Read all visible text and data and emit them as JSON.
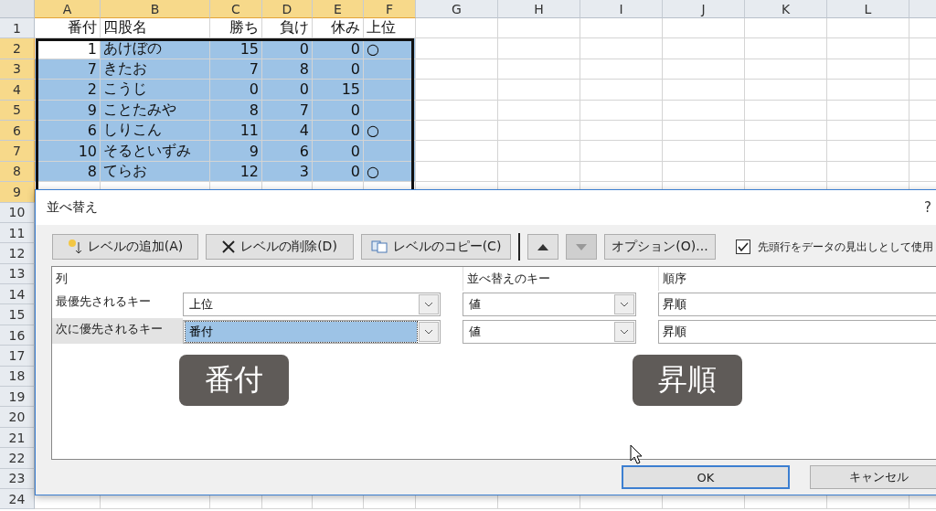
{
  "sheet": {
    "columns": [
      {
        "label": "A",
        "selected": true
      },
      {
        "label": "B",
        "selected": true
      },
      {
        "label": "C",
        "selected": true
      },
      {
        "label": "D",
        "selected": true
      },
      {
        "label": "E",
        "selected": true
      },
      {
        "label": "F",
        "selected": true
      },
      {
        "label": "G",
        "selected": false
      },
      {
        "label": "H",
        "selected": false
      },
      {
        "label": "I",
        "selected": false
      },
      {
        "label": "J",
        "selected": false
      },
      {
        "label": "K",
        "selected": false
      },
      {
        "label": "L",
        "selected": false
      }
    ],
    "row_headers": [
      {
        "label": "1",
        "selected": false
      },
      {
        "label": "2",
        "selected": true
      },
      {
        "label": "3",
        "selected": true
      },
      {
        "label": "4",
        "selected": true
      },
      {
        "label": "5",
        "selected": true
      },
      {
        "label": "6",
        "selected": true
      },
      {
        "label": "7",
        "selected": true
      },
      {
        "label": "8",
        "selected": true
      },
      {
        "label": "9",
        "selected": true
      },
      {
        "label": "10",
        "selected": false
      },
      {
        "label": "11",
        "selected": false
      },
      {
        "label": "12",
        "selected": false
      },
      {
        "label": "13",
        "selected": false
      },
      {
        "label": "14",
        "selected": false
      },
      {
        "label": "15",
        "selected": false
      },
      {
        "label": "16",
        "selected": false
      },
      {
        "label": "17",
        "selected": false
      },
      {
        "label": "18",
        "selected": false
      },
      {
        "label": "19",
        "selected": false
      },
      {
        "label": "20",
        "selected": false
      },
      {
        "label": "21",
        "selected": false
      },
      {
        "label": "22",
        "selected": false
      },
      {
        "label": "23",
        "selected": false
      },
      {
        "label": "24",
        "selected": false
      }
    ],
    "rows": [
      {
        "cells": [
          {
            "text": "番付",
            "selected": false
          },
          {
            "text": "四股名",
            "selected": false
          },
          {
            "text": "勝ち",
            "selected": false
          },
          {
            "text": "負け",
            "selected": false
          },
          {
            "text": "休み",
            "selected": false
          },
          {
            "text": "上位",
            "selected": false
          }
        ]
      },
      {
        "cells": [
          {
            "text": "1",
            "selected": false
          },
          {
            "text": "あけぼの",
            "selected": true
          },
          {
            "text": "15",
            "selected": true
          },
          {
            "text": "0",
            "selected": true
          },
          {
            "text": "0",
            "selected": true
          },
          {
            "text": "○",
            "selected": true
          }
        ]
      },
      {
        "cells": [
          {
            "text": "7",
            "selected": true
          },
          {
            "text": "きたお",
            "selected": true
          },
          {
            "text": "7",
            "selected": true
          },
          {
            "text": "8",
            "selected": true
          },
          {
            "text": "0",
            "selected": true
          },
          {
            "selected": true
          }
        ]
      },
      {
        "cells": [
          {
            "text": "2",
            "selected": true
          },
          {
            "text": "こうじ",
            "selected": true
          },
          {
            "text": "0",
            "selected": true
          },
          {
            "text": "0",
            "selected": true
          },
          {
            "text": "15",
            "selected": true
          },
          {
            "selected": true
          }
        ]
      },
      {
        "cells": [
          {
            "text": "9",
            "selected": true
          },
          {
            "text": "ことたみや",
            "selected": true
          },
          {
            "text": "8",
            "selected": true
          },
          {
            "text": "7",
            "selected": true
          },
          {
            "text": "0",
            "selected": true
          },
          {
            "selected": true
          }
        ]
      },
      {
        "cells": [
          {
            "text": "6",
            "selected": true
          },
          {
            "text": "しりこん",
            "selected": true
          },
          {
            "text": "11",
            "selected": true
          },
          {
            "text": "4",
            "selected": true
          },
          {
            "text": "0",
            "selected": true
          },
          {
            "text": "○",
            "selected": true
          }
        ]
      },
      {
        "cells": [
          {
            "text": "10",
            "selected": true
          },
          {
            "text": "そるといずみ",
            "selected": true
          },
          {
            "text": "9",
            "selected": true
          },
          {
            "text": "6",
            "selected": true
          },
          {
            "text": "0",
            "selected": true
          },
          {
            "selected": true
          }
        ]
      },
      {
        "cells": [
          {
            "text": "8",
            "selected": true
          },
          {
            "text": "てらお",
            "selected": true
          },
          {
            "text": "12",
            "selected": true
          },
          {
            "text": "3",
            "selected": true
          },
          {
            "text": "0",
            "selected": true
          },
          {
            "text": "○",
            "selected": true
          }
        ]
      }
    ]
  },
  "dialog": {
    "title": "並べ替え",
    "help": "?",
    "toolbar": [
      {
        "kind": "add",
        "label": "レベルの追加(A)",
        "disabled": false
      },
      {
        "kind": "delete",
        "label": "レベルの削除(D)",
        "disabled": false
      },
      {
        "kind": "copy",
        "label": "レベルのコピー(C)",
        "disabled": false
      },
      {
        "kind": "up",
        "disabled": false
      },
      {
        "kind": "down",
        "disabled": true
      },
      {
        "kind": "text",
        "label": "オプション(O)...",
        "disabled": false
      }
    ],
    "header_checkbox": {
      "label": "先頭行をデータの見出しとして使用",
      "checked": true
    },
    "columns": [
      "列",
      "並べ替えのキー",
      "順序"
    ],
    "levels": [
      {
        "label": "最優先されるキー",
        "column": "上位",
        "column_selected": false,
        "key": "値",
        "order": "昇順",
        "selected": false
      },
      {
        "label": "次に優先されるキー",
        "column": "番付",
        "column_selected": true,
        "key": "値",
        "order": "昇順",
        "selected": true
      }
    ],
    "buttons": [
      {
        "label": "OK",
        "default": true
      },
      {
        "label": "キャンセル",
        "default": false
      }
    ]
  },
  "annotations": [
    "番付",
    "昇順"
  ]
}
